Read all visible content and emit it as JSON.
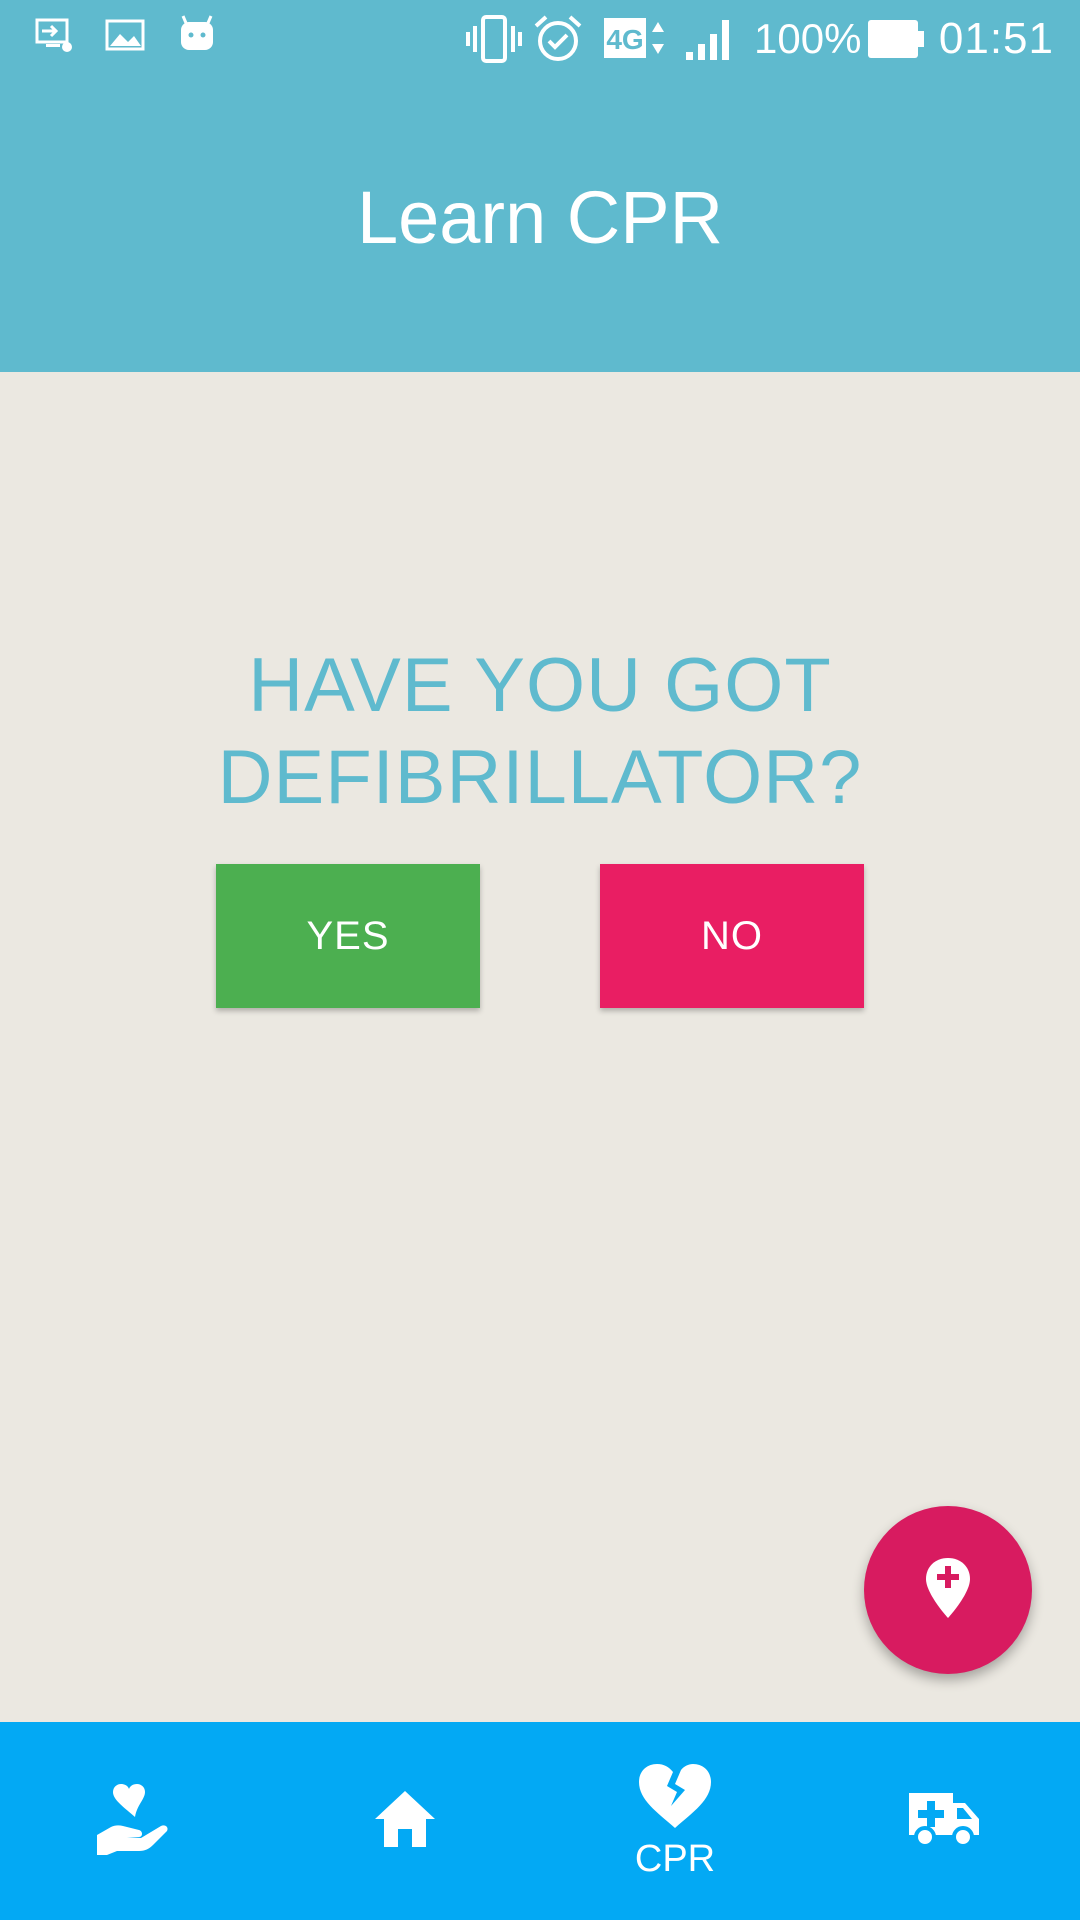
{
  "status_bar": {
    "battery_percent": "100%",
    "time": "01:51",
    "network": "4G",
    "icons": [
      "screencast-icon",
      "image-icon",
      "android-icon",
      "vibrate-icon",
      "alarm-icon",
      "network-4g-icon",
      "signal-icon",
      "battery-icon"
    ]
  },
  "app_bar": {
    "title": "Learn CPR"
  },
  "main": {
    "question": "HAVE YOU GOT DEFIBRILLATOR?",
    "yes_label": "YES",
    "no_label": "NO"
  },
  "fab": {
    "icon": "medical-location-icon"
  },
  "bottom_nav": {
    "items": [
      {
        "icon": "heart-hand-icon",
        "label": ""
      },
      {
        "icon": "home-icon",
        "label": ""
      },
      {
        "icon": "broken-heart-icon",
        "label": "CPR"
      },
      {
        "icon": "ambulance-icon",
        "label": ""
      }
    ],
    "active_index": 2
  },
  "colors": {
    "primary": "#5fbace",
    "background": "#ebe8e1",
    "yes": "#4caf50",
    "no": "#e91e63",
    "fab": "#d81b60",
    "nav": "#03a9f4"
  }
}
